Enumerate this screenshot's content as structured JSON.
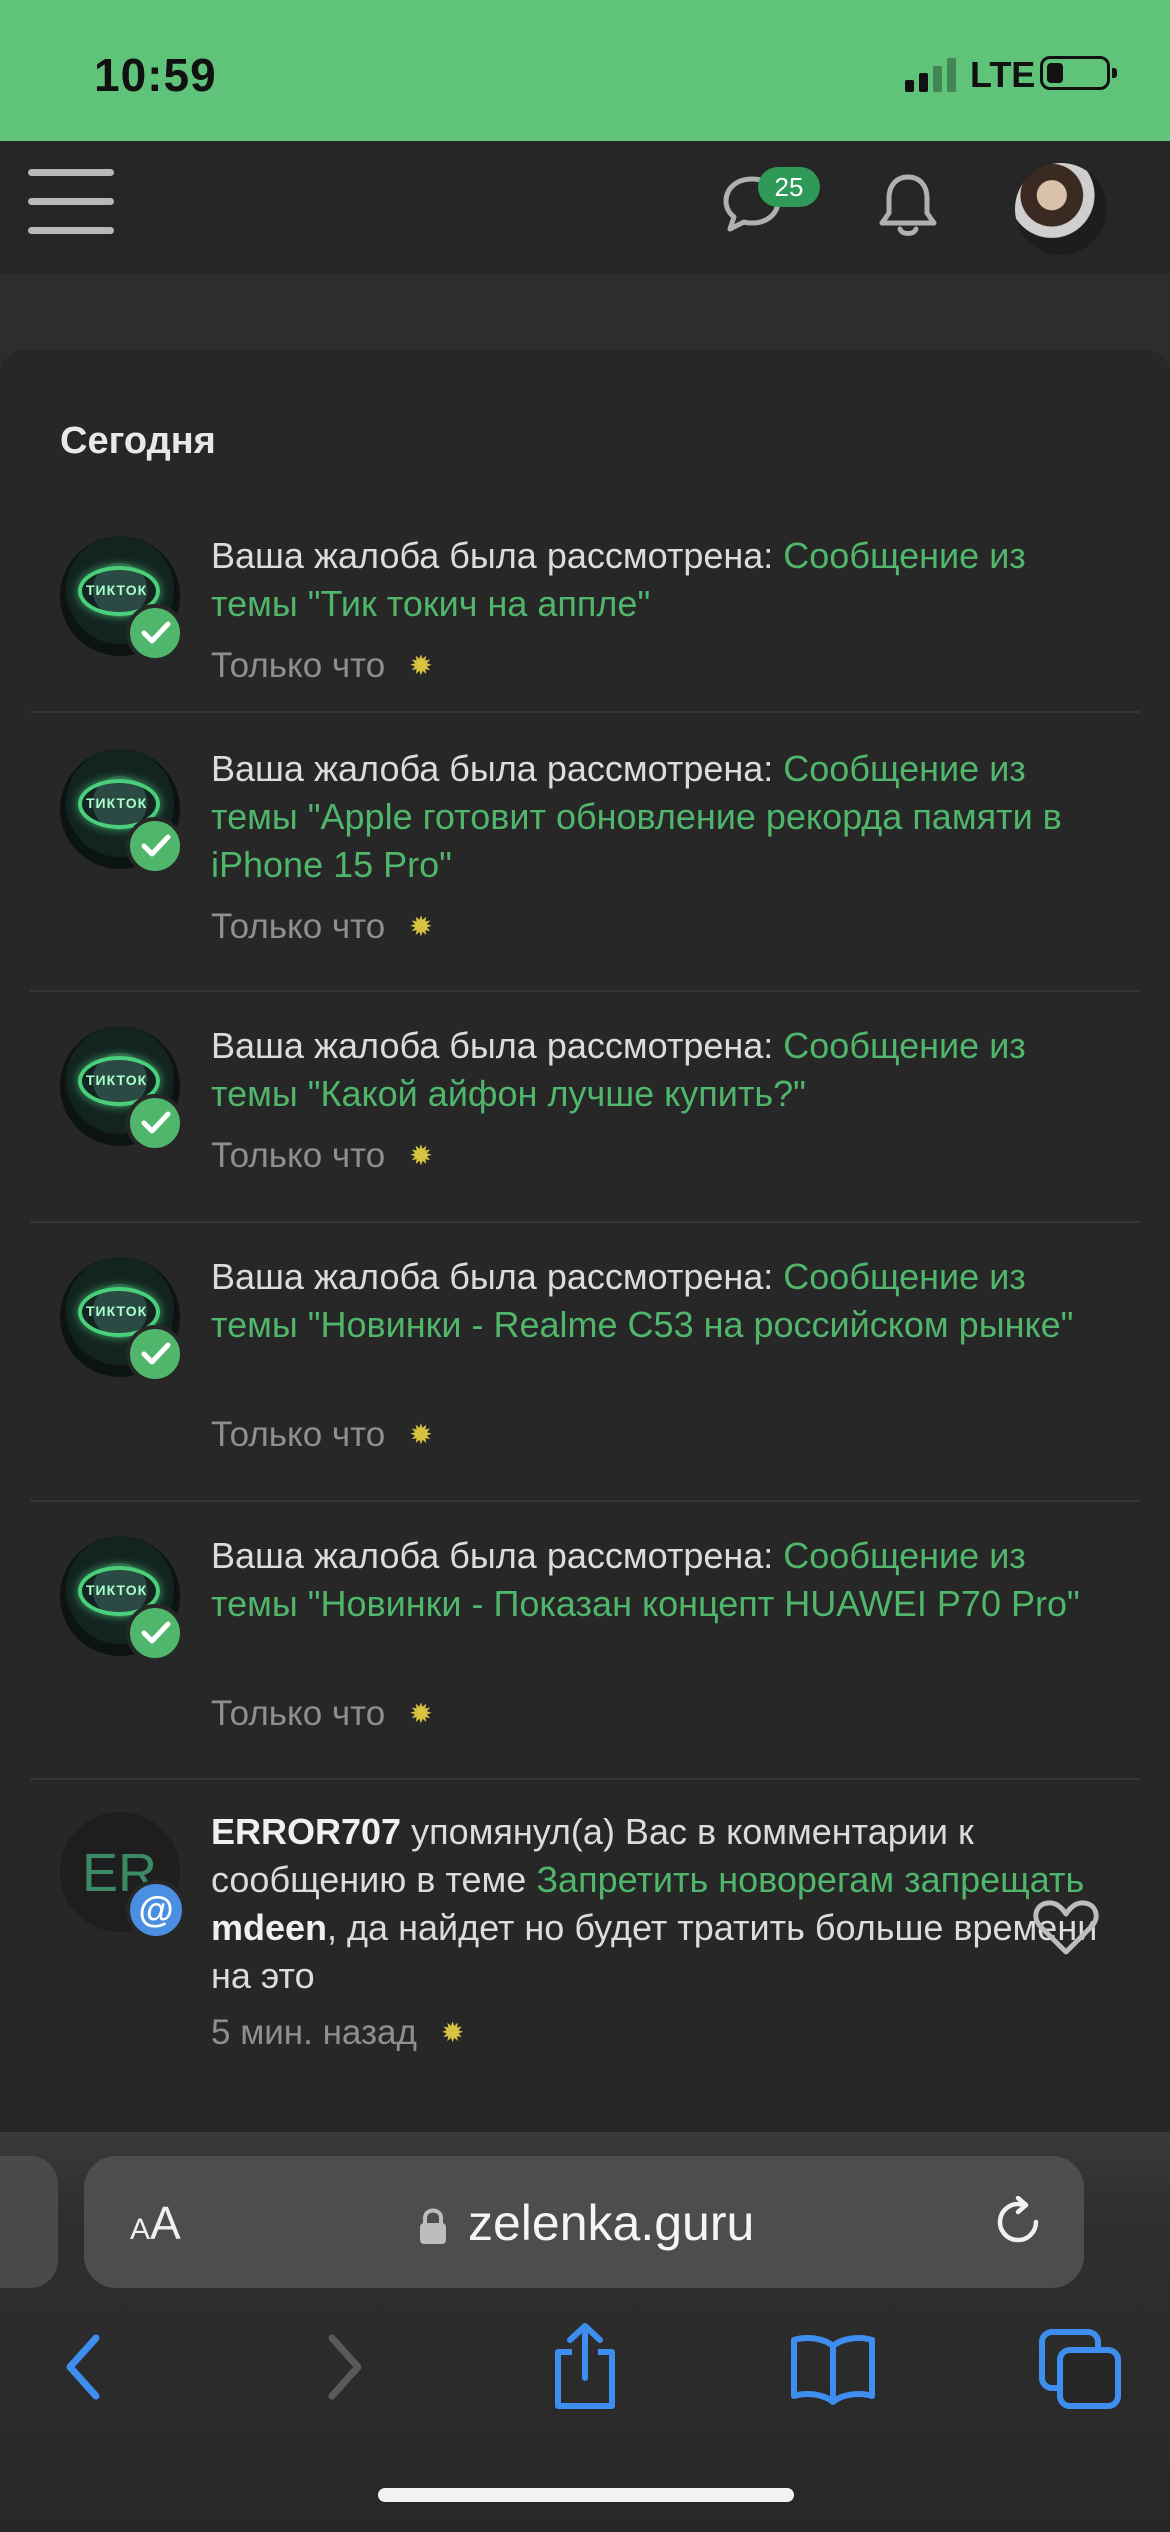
{
  "status_bar": {
    "time": "10:59",
    "network": "LTE"
  },
  "header": {
    "messages_badge": "25"
  },
  "section_title": "Сегодня",
  "alerts": [
    {
      "prefix": "Ваша жалоба была рассмотрена: ",
      "link": "Сообщение из темы \"Тик токич на аппле\"",
      "time": "Только что"
    },
    {
      "prefix": "Ваша жалоба была рассмотрена: ",
      "link": "Сообщение из темы \"Apple готовит обновление рекорда памяти в iPhone 15 Pro\"",
      "time": "Только что"
    },
    {
      "prefix": "Ваша жалоба была рассмотрена: ",
      "link": "Сообщение из темы \"Какой айфон лучше купить?\"",
      "time": "Только что"
    },
    {
      "prefix": "Ваша жалоба была рассмотрена: ",
      "link": "Сообщение из темы \"Новинки - Realme C53 на российском рынке\"",
      "time": "Только что"
    },
    {
      "prefix": "Ваша жалоба была рассмотрена: ",
      "link": "Сообщение из темы \"Новинки - Показан концепт HUAWEI P70 Pro\"",
      "time": "Только что"
    }
  ],
  "mention": {
    "avatar_initials": "ER",
    "user": "ERROR707",
    "action": " упомянул(а) Вас в комментарии к сообщению в теме ",
    "thread_link": "Запретить новорегам запрещать",
    "reply_user": "mdeen",
    "reply_text": ", да найдет но будет тратить больше времени на это",
    "time": "5 мин. назад"
  },
  "browser": {
    "url": "zelenka.guru",
    "text_size_label_small": "A",
    "text_size_label_large": "A"
  },
  "icons": {
    "menu": "hamburger-menu-icon",
    "messages": "chat-bubble-icon",
    "notifications": "bell-icon",
    "check": "check-icon",
    "mention": "at-icon",
    "like": "heart-icon",
    "lock": "lock-icon",
    "reload": "reload-icon",
    "back": "chevron-left-icon",
    "forward": "chevron-right-icon",
    "share": "share-icon",
    "bookmarks": "book-icon",
    "tabs": "tabs-icon"
  },
  "colors": {
    "accent_green": "#4fb66b",
    "status_bar": "#5fc37a",
    "background": "#272727",
    "badge_blue": "#4a8fe2",
    "ios_blue": "#3e8ef0"
  }
}
